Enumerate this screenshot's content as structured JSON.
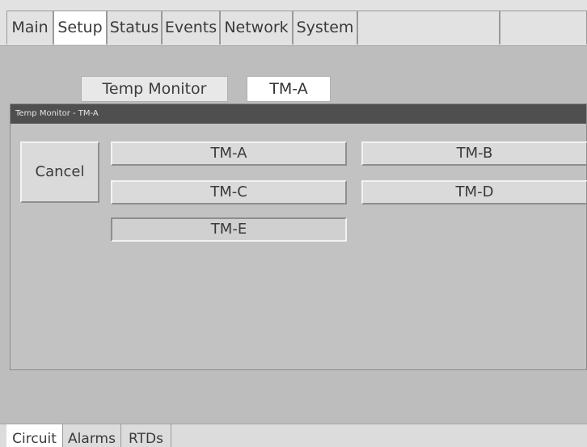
{
  "top_tabs": [
    {
      "label": "Main"
    },
    {
      "label": "Setup"
    },
    {
      "label": "Status"
    },
    {
      "label": "Events"
    },
    {
      "label": "Network"
    },
    {
      "label": "System"
    },
    {
      "label": ""
    },
    {
      "label": ""
    }
  ],
  "selector": {
    "label": "Temp Monitor",
    "value": "TM-A"
  },
  "dialog": {
    "title": "Temp Monitor - TM-A",
    "cancel_label": "Cancel",
    "options": [
      "TM-A",
      "TM-B",
      "TM-C",
      "TM-D",
      "TM-E"
    ]
  },
  "bottom_tabs": [
    {
      "label": "Circuit"
    },
    {
      "label": "Alarms"
    },
    {
      "label": "RTDs"
    }
  ]
}
